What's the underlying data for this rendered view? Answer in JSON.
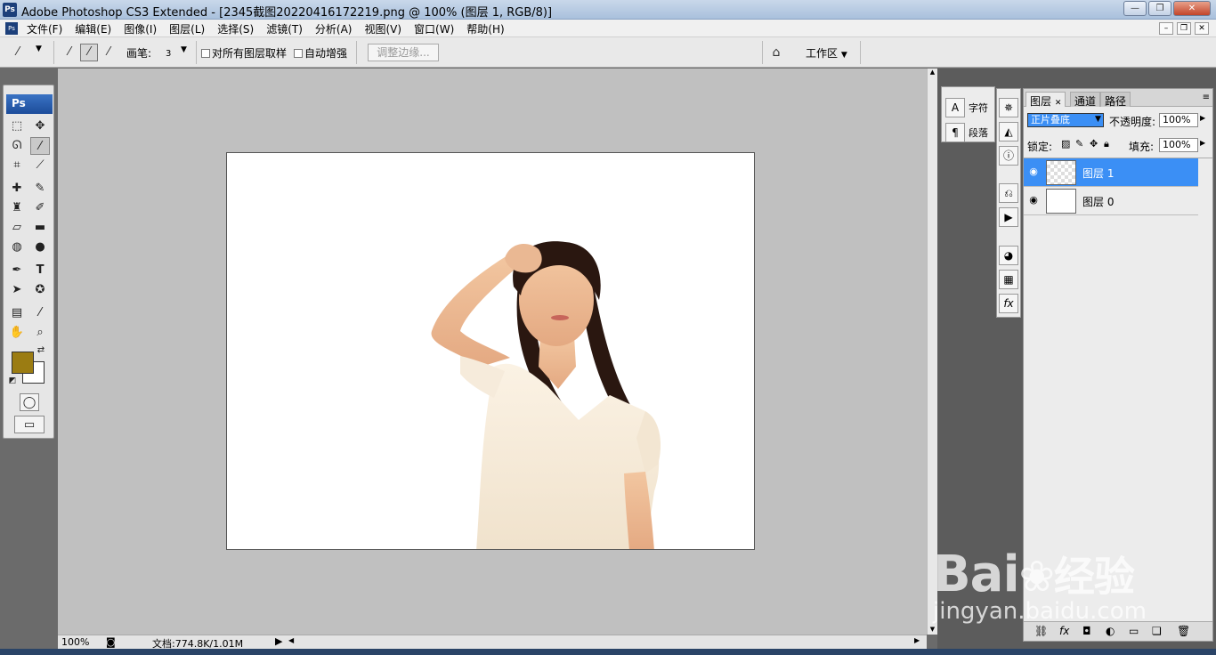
{
  "window": {
    "title": "Adobe Photoshop CS3 Extended - [2345截图20220416172219.png @ 100% (图层 1, RGB/8)]",
    "app_badge": "Ps"
  },
  "menu": {
    "items": [
      "文件(F)",
      "编辑(E)",
      "图像(I)",
      "图层(L)",
      "选择(S)",
      "滤镜(T)",
      "分析(A)",
      "视图(V)",
      "窗口(W)",
      "帮助(H)"
    ]
  },
  "options": {
    "brush_label": "画笔:",
    "brush_size": "3",
    "sample_all_layers": "对所有图层取样",
    "auto_enhance": "自动增强",
    "refine_edge": "调整边缘...",
    "workspace": "工作区"
  },
  "toolbox": {
    "badge": "Ps",
    "foreground_color": "#9b7c12",
    "background_color": "#ffffff"
  },
  "status": {
    "zoom": "100%",
    "doc_info": "文档:774.8K/1.01M"
  },
  "char_panel": {
    "character": "字符",
    "paragraph": "段落"
  },
  "layers_panel": {
    "tabs": [
      "图层",
      "通道",
      "路径"
    ],
    "blend_mode": "正片叠底",
    "opacity_label": "不透明度:",
    "opacity_value": "100%",
    "lock_label": "锁定:",
    "fill_label": "填充:",
    "fill_value": "100%",
    "layers": [
      {
        "name": "图层 1",
        "selected": true,
        "thumb": "transparent"
      },
      {
        "name": "图层 0",
        "selected": false,
        "thumb": "white"
      }
    ]
  },
  "watermark": {
    "brand": "Bai",
    "brand_suffix": "经验",
    "url": "jingyan.baidu.com"
  },
  "icons": [
    "magic-wand-icon",
    "eye-icon",
    "link-icon",
    "fx-icon",
    "mask-icon",
    "adjustment-icon",
    "folder-icon",
    "new-layer-icon",
    "trash-icon"
  ]
}
